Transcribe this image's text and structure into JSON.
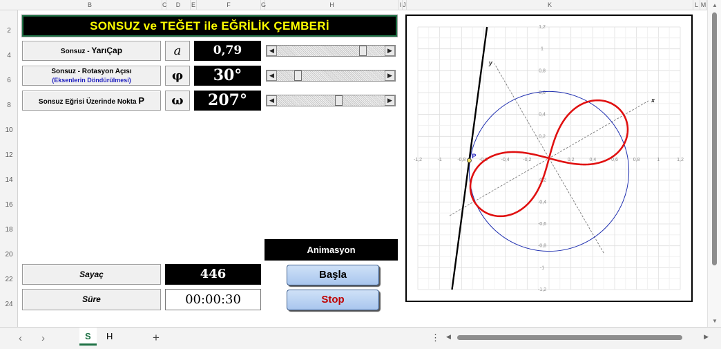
{
  "column_headers": [
    "B",
    "C",
    "D",
    "E",
    "F",
    "G",
    "H",
    "I",
    "J",
    "K",
    "L",
    "M"
  ],
  "row_headers": [
    "2",
    "4",
    "6",
    "8",
    "10",
    "12",
    "14",
    "16",
    "18",
    "20",
    "22",
    "24"
  ],
  "title": "SONSUZ  ve  TEĞET  ile  EĞRİLİK ÇEMBERİ",
  "rows": [
    {
      "label_prefix": "Sonsuz - ",
      "label_bold": "YarıÇap",
      "sublabel": "",
      "symbol": "a",
      "value": "0,79",
      "slider_position": 0.82
    },
    {
      "label_prefix": "Sonsuz - Rotasyon Açısı",
      "label_bold": "",
      "sublabel": "(Eksenlerin Döndürülmesi)",
      "symbol": "φ",
      "value": "30°",
      "slider_position": 0.17
    },
    {
      "label_prefix": "Sonsuz Eğrisi Üzerinde Nokta ",
      "label_bold": "P",
      "sublabel": "",
      "symbol": "ω",
      "value": "207°",
      "slider_position": 0.58
    }
  ],
  "animation": {
    "title": "Animasyon",
    "start_label": "Başla",
    "stop_label": "Stop"
  },
  "counter": {
    "label": "Sayaç",
    "value": "446"
  },
  "duration": {
    "label": "Süre",
    "value": "00:00:30"
  },
  "chart_data": {
    "type": "scatter",
    "title": "",
    "xlabel": "x",
    "ylabel": "y",
    "point_label": "P",
    "xlim": [
      -1.2,
      1.2
    ],
    "ylim": [
      -1.2,
      1.2
    ],
    "x_ticks": [
      "-1,2",
      "-1",
      "-0,8",
      "-0,6",
      "-0,4",
      "-0,2",
      "0,2",
      "0,4",
      "0,6",
      "0,8",
      "1",
      "1,2"
    ],
    "y_ticks": [
      "1,2",
      "1",
      "0,8",
      "0,6",
      "0,4",
      "0,2",
      "-0,2",
      "-0,4",
      "-0,6",
      "-0,8",
      "-1",
      "-1,2"
    ],
    "grid": true,
    "a": 0.79,
    "phi_deg": 30,
    "omega_deg": 207,
    "series": [
      {
        "kind": "lemniscate",
        "color": "#e01010"
      },
      {
        "kind": "osculating-circle",
        "color": "#2030b0",
        "center": [
          0.0,
          -0.12
        ],
        "radius": 0.73
      },
      {
        "kind": "tangent-line",
        "color": "#000000"
      },
      {
        "kind": "rotated-axes",
        "color": "#777777"
      }
    ],
    "point": {
      "x": -0.73,
      "y": -0.02,
      "color": "#f0e060"
    }
  },
  "sheet_tabs": [
    {
      "label": "S",
      "active": true
    },
    {
      "label": "H",
      "active": false
    }
  ],
  "nav": {
    "prev": "‹",
    "next": "›",
    "add": "+",
    "more": "⋮"
  }
}
